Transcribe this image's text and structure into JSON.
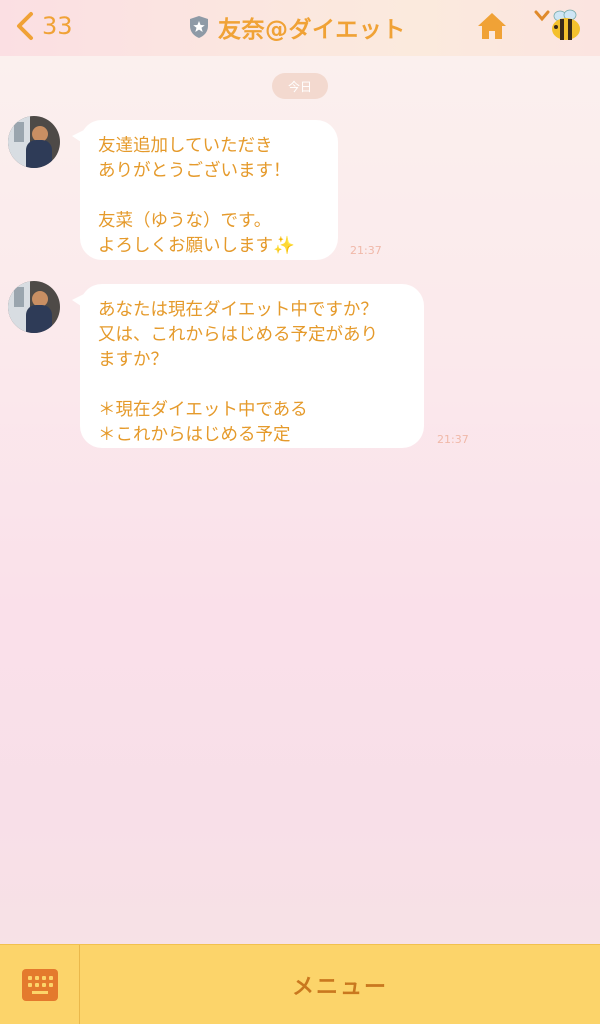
{
  "header": {
    "back_count": "33",
    "title": "友奈@ダイエット",
    "icons": [
      "chevron-left-icon",
      "shield-star-icon",
      "home-icon",
      "chevron-down-icon",
      "bee-icon"
    ],
    "accent": "#f0a236"
  },
  "date_label": "今日",
  "messages": [
    {
      "text": "友達追加していただき\nありがとうございます！\n\n友菜（ゆうな）です。\nよろしくお願いします✨",
      "time": "21:37"
    },
    {
      "text": "あなたは現在ダイエット中ですか？\n又は、これからはじめる予定があり\nますか？\n\n＊現在ダイエット中である\n＊これからはじめる予定",
      "time": "21:37"
    }
  ],
  "footer": {
    "menu_label": "メニュー",
    "bg": "#fcd46a"
  }
}
